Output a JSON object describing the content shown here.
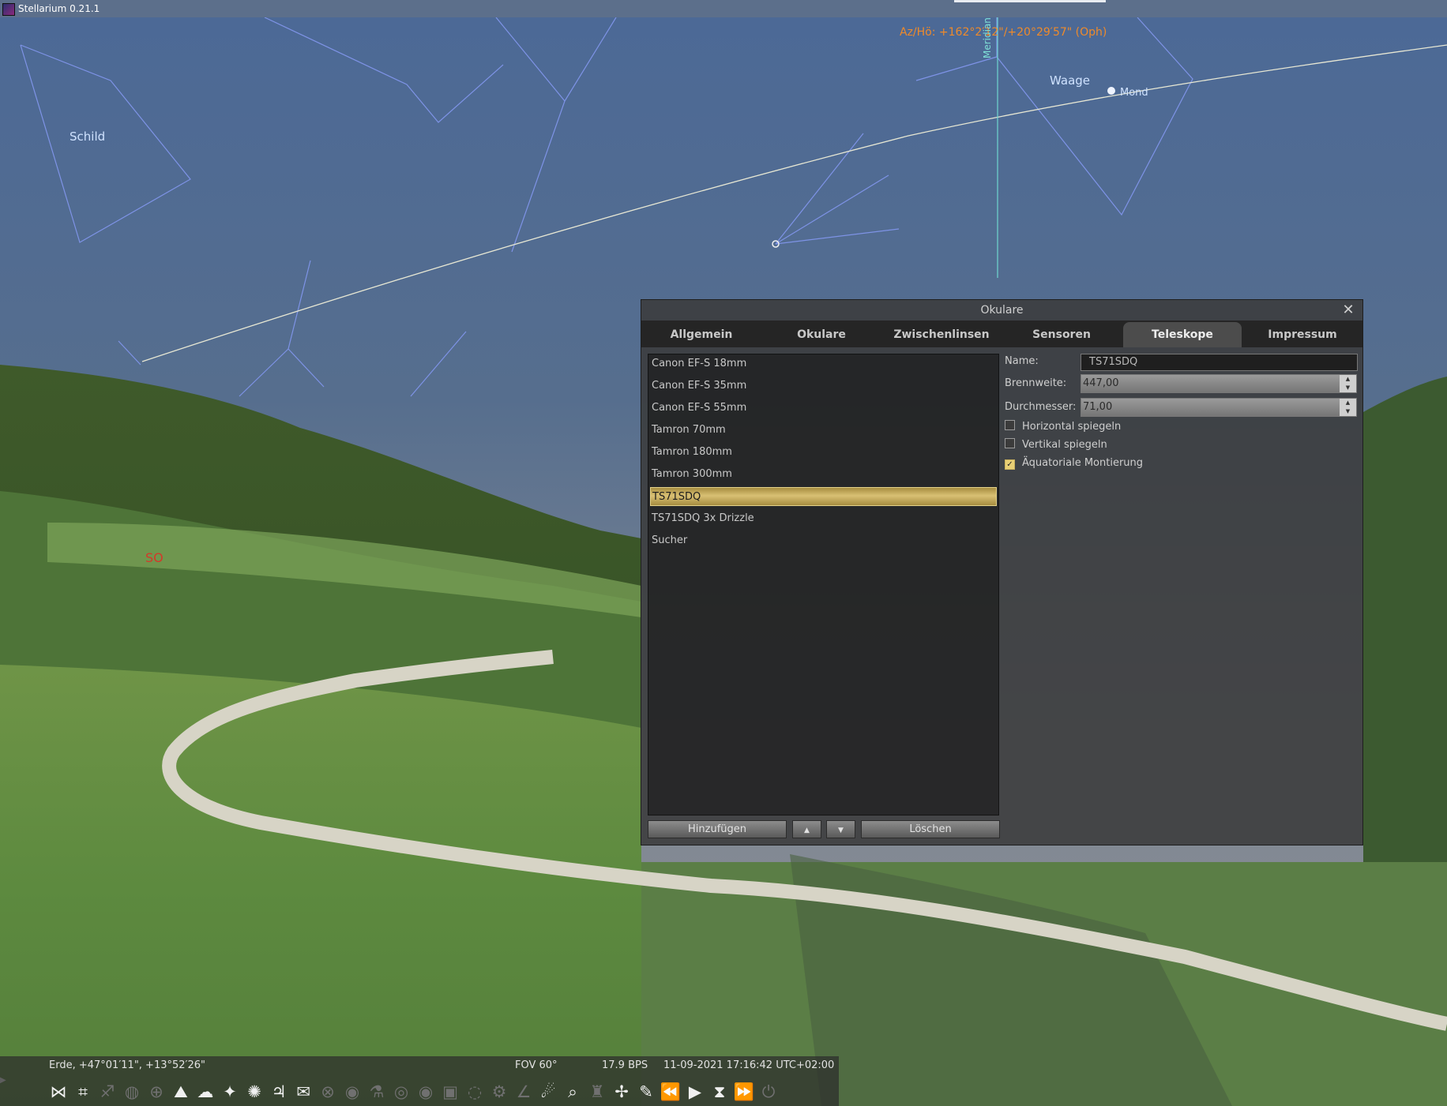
{
  "window": {
    "title": "Stellarium 0.21.1"
  },
  "sky": {
    "coordinates": "Az/Hö: +162°2′12\"/+20°29′57\" (Oph)",
    "meridian_label": "Meridian",
    "constellations": [
      "Schild",
      "Waage"
    ],
    "moon_label": "Mond",
    "cardinal_label": "SO"
  },
  "dialog": {
    "title": "Okulare",
    "tabs": [
      "Allgemein",
      "Okulare",
      "Zwischenlinsen",
      "Sensoren",
      "Teleskope",
      "Impressum"
    ],
    "active_tab": "Teleskope",
    "telescopes": [
      "Canon EF-S 18mm",
      "Canon EF-S 35mm",
      "Canon EF-S 55mm",
      "Tamron 70mm",
      "Tamron 180mm",
      "Tamron 300mm",
      "TS71SDQ",
      "TS71SDQ 3x Drizzle",
      "Sucher"
    ],
    "selected_telescope": "TS71SDQ",
    "buttons": {
      "add": "Hinzufügen",
      "delete": "Löschen"
    },
    "fields": {
      "name_label": "Name:",
      "name_value": "TS71SDQ",
      "focal_label": "Brennweite:",
      "focal_value": "447,00",
      "diameter_label": "Durchmesser:",
      "diameter_value": "71,00"
    },
    "checkboxes": [
      {
        "label": "Horizontal spiegeln",
        "checked": false
      },
      {
        "label": "Vertikal spiegeln",
        "checked": false
      },
      {
        "label": "Äquatoriale Montierung",
        "checked": true
      }
    ]
  },
  "status_bar": {
    "location": "Erde, +47°01′11\", +13°52′26\"",
    "fov": "FOV 60°",
    "fps": "17.9 BPS",
    "datetime": "11-09-2021 17:16:42 UTC+02:00"
  },
  "toolbar_icons": [
    {
      "name": "constellation-lines-icon",
      "glyph": "⋈",
      "active": true
    },
    {
      "name": "constellation-labels-icon",
      "glyph": "⌗",
      "active": true
    },
    {
      "name": "constellation-art-icon",
      "glyph": "♐",
      "active": false
    },
    {
      "name": "equatorial-grid-icon",
      "glyph": "◍",
      "active": false
    },
    {
      "name": "azimuthal-grid-icon",
      "glyph": "⊕",
      "active": false
    },
    {
      "name": "ground-icon",
      "glyph": "⛰",
      "active": true
    },
    {
      "name": "atmosphere-icon",
      "glyph": "☁",
      "active": true
    },
    {
      "name": "cardinal-points-icon",
      "glyph": "✦",
      "active": true
    },
    {
      "name": "nebulae-icon",
      "glyph": "✺",
      "active": true
    },
    {
      "name": "planet-labels-icon",
      "glyph": "♃",
      "active": true
    },
    {
      "name": "satellites-icon",
      "glyph": "✉",
      "active": true
    },
    {
      "name": "equatorial-mount-icon",
      "glyph": "⊗",
      "active": false
    },
    {
      "name": "night-mode-icon",
      "glyph": "◉",
      "active": false
    },
    {
      "name": "telescope-control-icon",
      "glyph": "⚗",
      "active": false
    },
    {
      "name": "ocular-view-icon",
      "glyph": "◎",
      "active": false
    },
    {
      "name": "eye-icon",
      "glyph": "◉",
      "active": false
    },
    {
      "name": "sensor-frame-icon",
      "glyph": "▣",
      "active": false
    },
    {
      "name": "telrad-icon",
      "glyph": "◌",
      "active": false
    },
    {
      "name": "ocular-config-icon",
      "glyph": "⚙",
      "active": false
    },
    {
      "name": "angle-measure-icon",
      "glyph": "∠",
      "active": false
    },
    {
      "name": "meteor-showers-icon",
      "glyph": "☄",
      "active": true
    },
    {
      "name": "search-icon",
      "glyph": "⌕",
      "active": true
    },
    {
      "name": "observatory-icon",
      "glyph": "♜",
      "active": false
    },
    {
      "name": "exoplanets-icon",
      "glyph": "✢",
      "active": true
    },
    {
      "name": "comet-icon",
      "glyph": "✎",
      "active": true
    },
    {
      "name": "rewind-icon",
      "glyph": "⏪",
      "active": false
    },
    {
      "name": "play-icon",
      "glyph": "▶",
      "active": true
    },
    {
      "name": "current-time-icon",
      "glyph": "⧗",
      "active": true
    },
    {
      "name": "fast-forward-icon",
      "glyph": "⏩",
      "active": false
    },
    {
      "name": "quit-icon",
      "glyph": "⏻",
      "active": false
    }
  ]
}
